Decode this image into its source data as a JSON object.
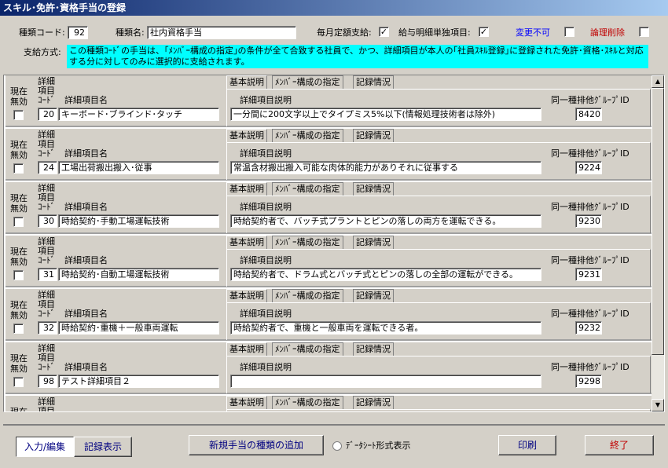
{
  "window": {
    "title": "スキル･免許･資格手当の登録"
  },
  "header": {
    "type_code_label": "種類コード:",
    "type_code_value": "92",
    "type_name_label": "種類名:",
    "type_name_value": "社内資格手当",
    "monthly_fixed_label": "毎月定額支給:",
    "monthly_fixed_checked": "✓",
    "payslip_item_label": "給与明細単独項目:",
    "payslip_item_checked": "✓",
    "unchangeable_label": "変更不可",
    "logical_delete_label": "論理削除",
    "method_label": "支給方式:",
    "method_text": "この種類ｺｰﾄﾞの手当は、｢ﾒﾝﾊﾞｰ構成の指定｣の条件が全て合致する社員で、かつ、詳細項目が本人の｢社員ｽｷﾙ登録｣に登録された免許･資格･ｽｷﾙと対応する分に対してのみに選択的に支給されます。",
    "label_color_unchangeable": "#0000ff",
    "label_color_delete": "#c00000"
  },
  "record_labels": {
    "invalid_line1": "現在",
    "invalid_line2": "無効",
    "detail_line1": "詳細",
    "detail_line2": "項目",
    "detail_line3": "ｺｰﾄﾞ",
    "item_name": "詳細項目名",
    "item_desc": "詳細項目説明",
    "group_id": "同一種排他ｸﾞﾙｰﾌﾟID",
    "tab_basic": "基本説明",
    "tab_member": "ﾒﾝﾊﾞｰ構成の指定",
    "tab_record": "記録情況"
  },
  "records": [
    {
      "code": "20",
      "name": "キーボード･ブラインド･タッチ",
      "desc": "一分間に200文字以上でタイプミス5%以下(情報処理技術者は除外)",
      "group": "8420"
    },
    {
      "code": "24",
      "name": "工場出荷搬出搬入･従事",
      "desc": "常温含材搬出搬入可能な肉体的能力がありそれに従事する",
      "group": "9224"
    },
    {
      "code": "30",
      "name": "時給契約･手動工場運転技術",
      "desc": "時給契約者で、バッチ式プラントとピンの落しの両方を運転できる。",
      "group": "9230"
    },
    {
      "code": "31",
      "name": "時給契約･自動工場運転技術",
      "desc": "時給契約者で、ドラム式とバッチ式とピンの落しの全部の運転ができる。",
      "group": "9231"
    },
    {
      "code": "32",
      "name": "時給契約･重機＋一般車両運転",
      "desc": "時給契約者で、重機と一般車両を運転できる者。",
      "group": "9232"
    },
    {
      "code": "98",
      "name": "テスト詳細項目２",
      "desc": "",
      "group": "9298"
    }
  ],
  "footer": {
    "input_edit": "入力/編集",
    "record_view": "記録表示",
    "add_type": "新規手当の種類の追加",
    "datasheet_view": "ﾃﾞｰﾀｼｰﾄ形式表示",
    "print": "印刷",
    "exit": "終了"
  }
}
